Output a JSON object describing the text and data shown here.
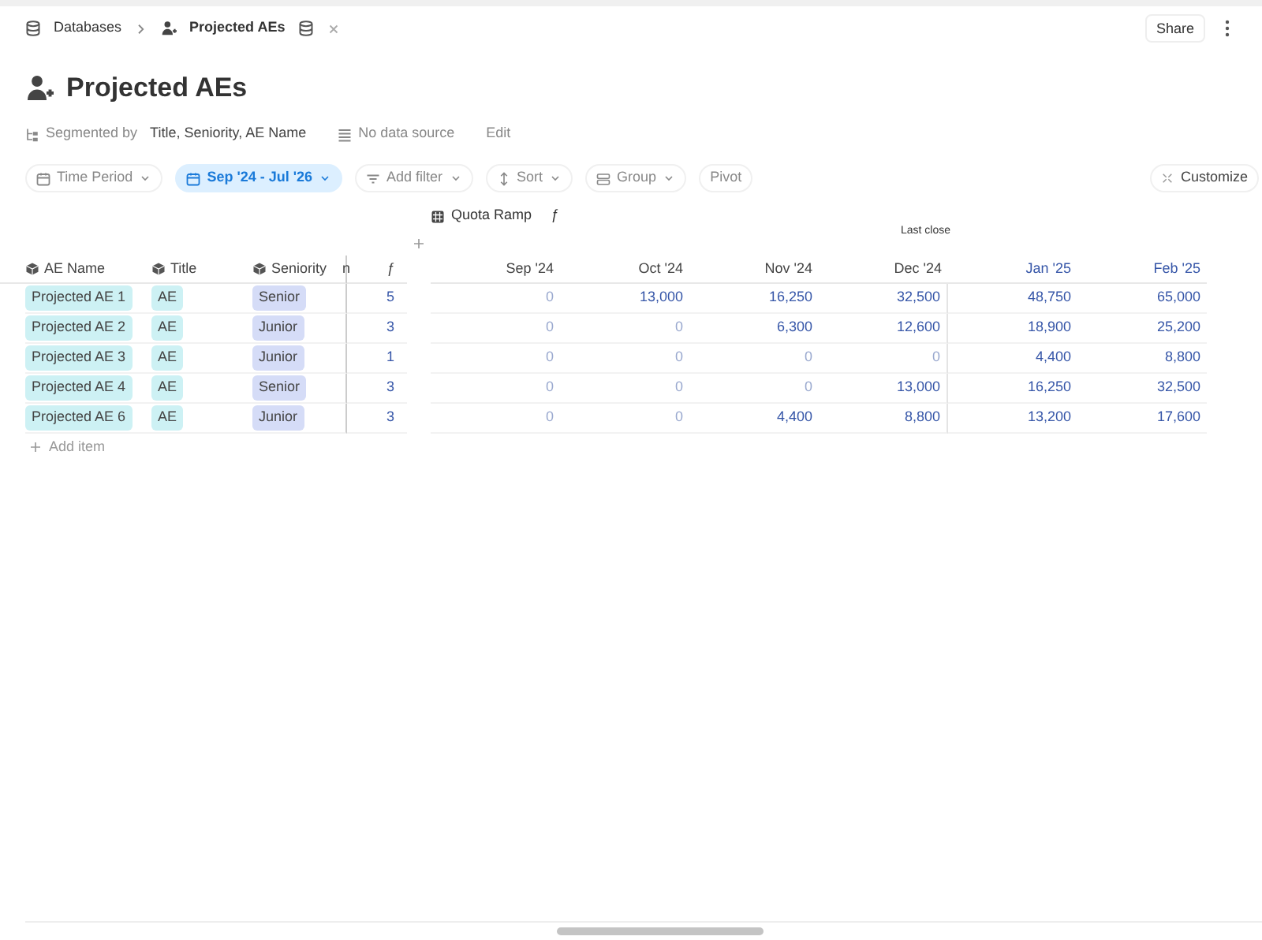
{
  "breadcrumb": [
    {
      "label": "Databases"
    },
    {
      "label": "Projected AEs"
    }
  ],
  "share": "Share",
  "title": "Projected AEs",
  "meta": {
    "segmented_label": "Segmented by",
    "segmented_value": "Title, Seniority, AE Name",
    "data_source": "No data source",
    "edit": "Edit"
  },
  "toolbar": [
    {
      "label": "Time Period",
      "kind": "dropdown",
      "selected": false
    },
    {
      "label": "Sep '24 - Jul '26",
      "kind": "dropdown",
      "selected": true
    },
    {
      "label": "Add filter",
      "kind": "dropdown",
      "selected": false
    },
    {
      "label": "Sort",
      "kind": "dropdown",
      "selected": false
    },
    {
      "label": "Group",
      "kind": "dropdown",
      "selected": false
    },
    {
      "label": "Pivot",
      "kind": "plain",
      "selected": false
    }
  ],
  "customize": "Customize",
  "metric": {
    "title": "Quota Ramp",
    "symbol": "ƒ",
    "marker": "Last close"
  },
  "left_columns": [
    {
      "label": "AE Name",
      "kind": "name"
    },
    {
      "label": "Title",
      "kind": "title"
    },
    {
      "label": "Seniority",
      "kind": "tag"
    },
    {
      "label": "n",
      "symbol": "ƒ",
      "kind": "number"
    }
  ],
  "month_columns": [
    {
      "label": "Sep '24",
      "forecast": false
    },
    {
      "label": "Oct '24",
      "forecast": false
    },
    {
      "label": "Nov '24",
      "forecast": false
    },
    {
      "label": "Dec '24",
      "forecast": false
    },
    {
      "label": "Jan '25",
      "forecast": true
    },
    {
      "label": "Feb '25",
      "forecast": true
    }
  ],
  "rows": [
    {
      "cells": [
        "Projected AE 1",
        "AE",
        "Senior",
        "5"
      ],
      "values": [
        {
          "v": "0",
          "dim": true
        },
        {
          "v": "13,000",
          "dim": false
        },
        {
          "v": "16,250",
          "dim": false
        },
        {
          "v": "32,500",
          "dim": false
        },
        {
          "v": "48,750",
          "dim": false
        },
        {
          "v": "65,000",
          "dim": false
        }
      ]
    },
    {
      "cells": [
        "Projected AE 2",
        "AE",
        "Junior",
        "3"
      ],
      "values": [
        {
          "v": "0",
          "dim": true
        },
        {
          "v": "0",
          "dim": true
        },
        {
          "v": "6,300",
          "dim": false
        },
        {
          "v": "12,600",
          "dim": false
        },
        {
          "v": "18,900",
          "dim": false
        },
        {
          "v": "25,200",
          "dim": false
        }
      ]
    },
    {
      "cells": [
        "Projected AE 3",
        "AE",
        "Junior",
        "1"
      ],
      "values": [
        {
          "v": "0",
          "dim": true
        },
        {
          "v": "0",
          "dim": true
        },
        {
          "v": "0",
          "dim": true
        },
        {
          "v": "0",
          "dim": true
        },
        {
          "v": "4,400",
          "dim": false
        },
        {
          "v": "8,800",
          "dim": false
        }
      ]
    },
    {
      "cells": [
        "Projected AE 4",
        "AE",
        "Senior",
        "3"
      ],
      "values": [
        {
          "v": "0",
          "dim": true
        },
        {
          "v": "0",
          "dim": true
        },
        {
          "v": "0",
          "dim": true
        },
        {
          "v": "13,000",
          "dim": false
        },
        {
          "v": "16,250",
          "dim": false
        },
        {
          "v": "32,500",
          "dim": false
        }
      ]
    },
    {
      "cells": [
        "Projected AE 6",
        "AE",
        "Junior",
        "3"
      ],
      "values": [
        {
          "v": "0",
          "dim": true
        },
        {
          "v": "0",
          "dim": true
        },
        {
          "v": "4,400",
          "dim": false
        },
        {
          "v": "8,800",
          "dim": false
        },
        {
          "v": "13,200",
          "dim": false
        },
        {
          "v": "17,600",
          "dim": false
        }
      ]
    }
  ],
  "add_item": "Add item"
}
